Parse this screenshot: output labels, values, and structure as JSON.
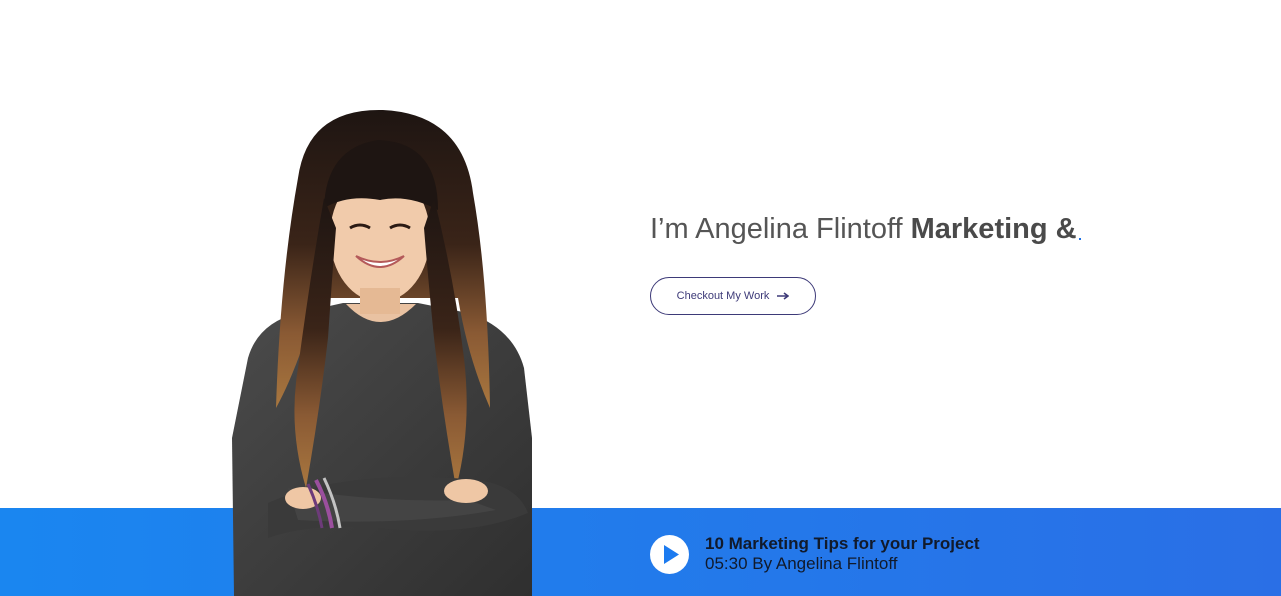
{
  "hero": {
    "intro_text": "I’m Angelina Flintoff ",
    "highlight_text": "Marketing &",
    "cta_label": "Checkout My Work"
  },
  "featured_video": {
    "title": "10 Marketing Tips for your Project",
    "meta": "05:30 By Angelina Flintoff"
  },
  "colors": {
    "bar_start": "#1a86f0",
    "bar_end": "#2a6fe6",
    "button_border": "#3d3a78",
    "heading_text": "#555555",
    "video_text": "#111a2b"
  },
  "icons": {
    "cta": "arrow-right-icon",
    "video": "play-icon"
  }
}
